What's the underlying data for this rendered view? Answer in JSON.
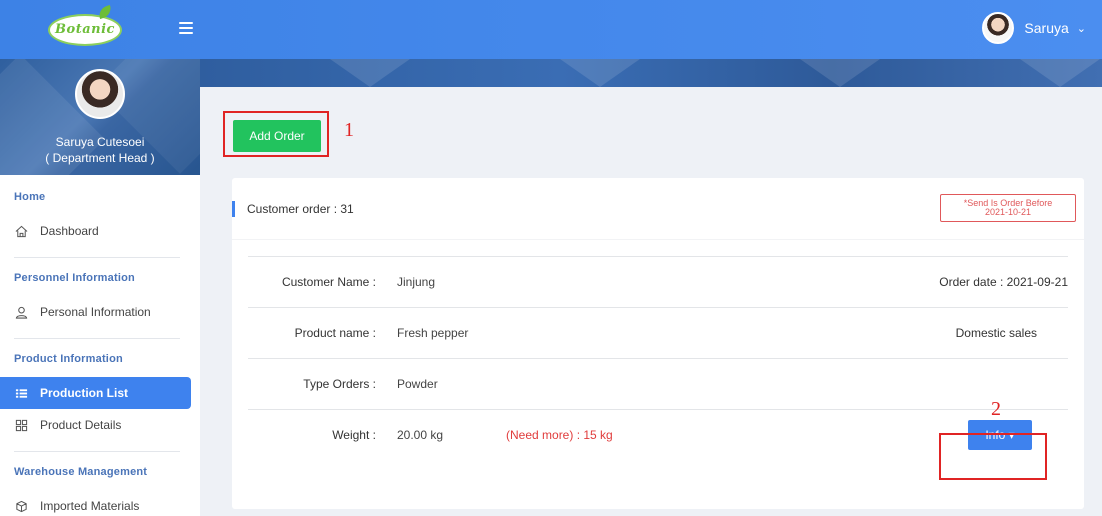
{
  "header": {
    "logo_text": "Botanic",
    "user_name": "Saruya"
  },
  "profile": {
    "name": "Saruya Cutesoei",
    "role": "( Department Head )"
  },
  "sidebar": {
    "sections": [
      {
        "title": "Home",
        "items": [
          {
            "label": "Dashboard",
            "icon": "home-icon"
          }
        ]
      },
      {
        "title": "Personnel Information",
        "items": [
          {
            "label": "Personal Information",
            "icon": "user-icon"
          }
        ]
      },
      {
        "title": "Product Information",
        "items": [
          {
            "label": "Production List",
            "icon": "list-icon",
            "active": true
          },
          {
            "label": "Product Details",
            "icon": "grid-icon"
          }
        ]
      },
      {
        "title": "Warehouse Management",
        "items": [
          {
            "label": "Imported Materials",
            "icon": "box-icon"
          }
        ]
      }
    ]
  },
  "toolbar": {
    "add_label": "Add Order"
  },
  "annotations": {
    "one": "1",
    "two": "2"
  },
  "order": {
    "title": "Customer order : 31",
    "badge_line1": "*Send Is Order Before",
    "badge_line2": "2021-10-21",
    "customer_label": "Customer Name :",
    "customer_value": "Jinjung",
    "order_date": "Order date : 2021-09-21",
    "product_label": "Product name :",
    "product_value": "Fresh pepper",
    "sales_type": "Domestic sales",
    "type_label": "Type Orders :",
    "type_value": "Powder",
    "weight_label": "Weight :",
    "weight_value": "20.00 kg",
    "need_more": "(Need more) : 15 kg",
    "info_label": "Info ▾"
  },
  "colors": {
    "primary": "#3e82ee",
    "success": "#22c35e",
    "danger": "#e0585a",
    "annotation": "#e02424"
  }
}
